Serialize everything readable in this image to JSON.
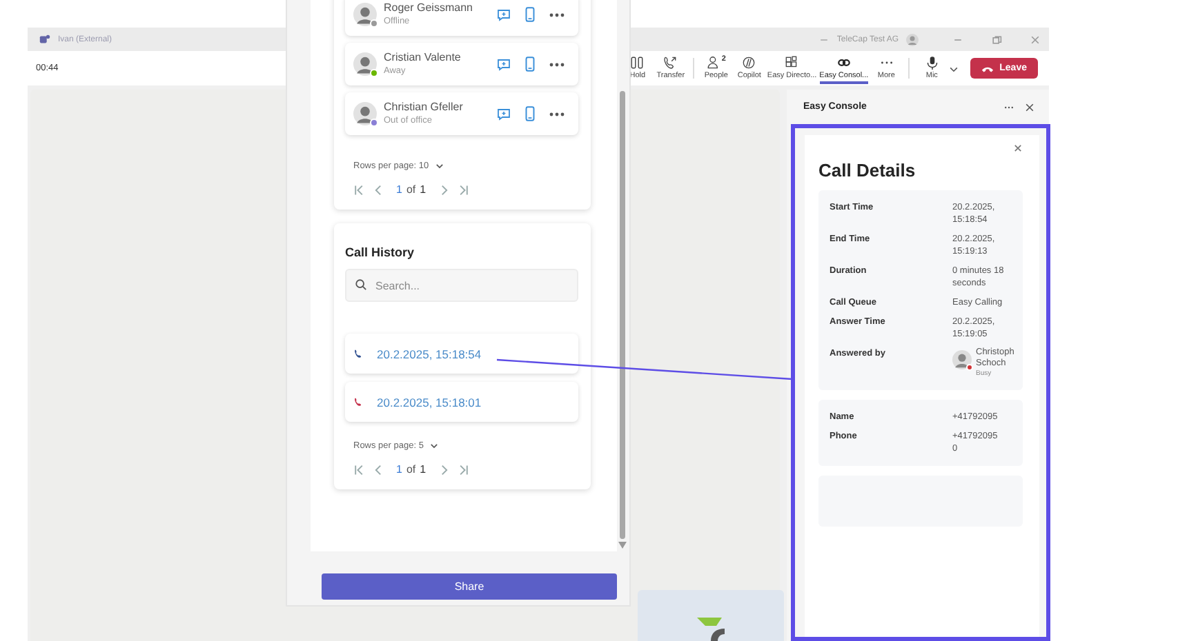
{
  "meeting_window": {
    "title": "Ivan (External)",
    "org": "TeleCap Test AG",
    "timer": "00:44",
    "toolbar": [
      {
        "label": "Hold",
        "selected": false
      },
      {
        "label": "Transfer",
        "selected": false
      },
      {
        "label": "People",
        "badge": "2",
        "selected": false
      },
      {
        "label": "Copilot",
        "selected": false
      },
      {
        "label": "Easy Directo...",
        "selected": false
      },
      {
        "label": "Easy Consol...",
        "selected": true
      },
      {
        "label": "More",
        "selected": false
      },
      {
        "label": "Mic",
        "selected": false
      }
    ],
    "leave_button": "Leave",
    "side_panel": {
      "title": "Easy Console"
    }
  },
  "call_details": {
    "title": "Call Details",
    "fields": [
      {
        "label": "Start Time",
        "value": "20.2.2025, 15:18:54"
      },
      {
        "label": "End Time",
        "value": "20.2.2025, 15:19:13"
      },
      {
        "label": "Duration",
        "value": "0 minutes 18 seconds"
      },
      {
        "label": "Call Queue",
        "value": "Easy Calling"
      },
      {
        "label": "Answer Time",
        "value": "20.2.2025, 15:19:05"
      }
    ],
    "answered_by": {
      "label": "Answered by",
      "name": "Christoph Schoch",
      "status": "Busy",
      "color": "#d13438"
    },
    "caller": [
      {
        "label": "Name",
        "lines": [
          "+41792095"
        ]
      },
      {
        "label": "Phone",
        "lines": [
          "+41792095",
          "0"
        ]
      }
    ]
  },
  "directory_panel": {
    "contacts": [
      {
        "name": "Roger Geissmann",
        "status": "Offline",
        "color": "#9a9a9a"
      },
      {
        "name": "Cristian Valente",
        "status": "Away",
        "color": "#6bb700"
      },
      {
        "name": "Christian Gfeller",
        "status": "Out of office",
        "color": "#8a7fd6"
      }
    ],
    "contacts_pager": {
      "rows_per_page": "Rows per page: 10",
      "page": "1",
      "of": "of",
      "total": "1"
    },
    "call_history": {
      "title": "Call History",
      "placeholder": "Search...",
      "calls": [
        {
          "time": "20.2.2025, 15:18:54",
          "kind": "answered"
        },
        {
          "time": "20.2.2025, 15:18:01",
          "kind": "missed"
        }
      ],
      "pager": {
        "rows_per_page": "Rows per page: 5",
        "page": "1",
        "of": "of",
        "total": "1"
      }
    },
    "share_button": "Share"
  }
}
